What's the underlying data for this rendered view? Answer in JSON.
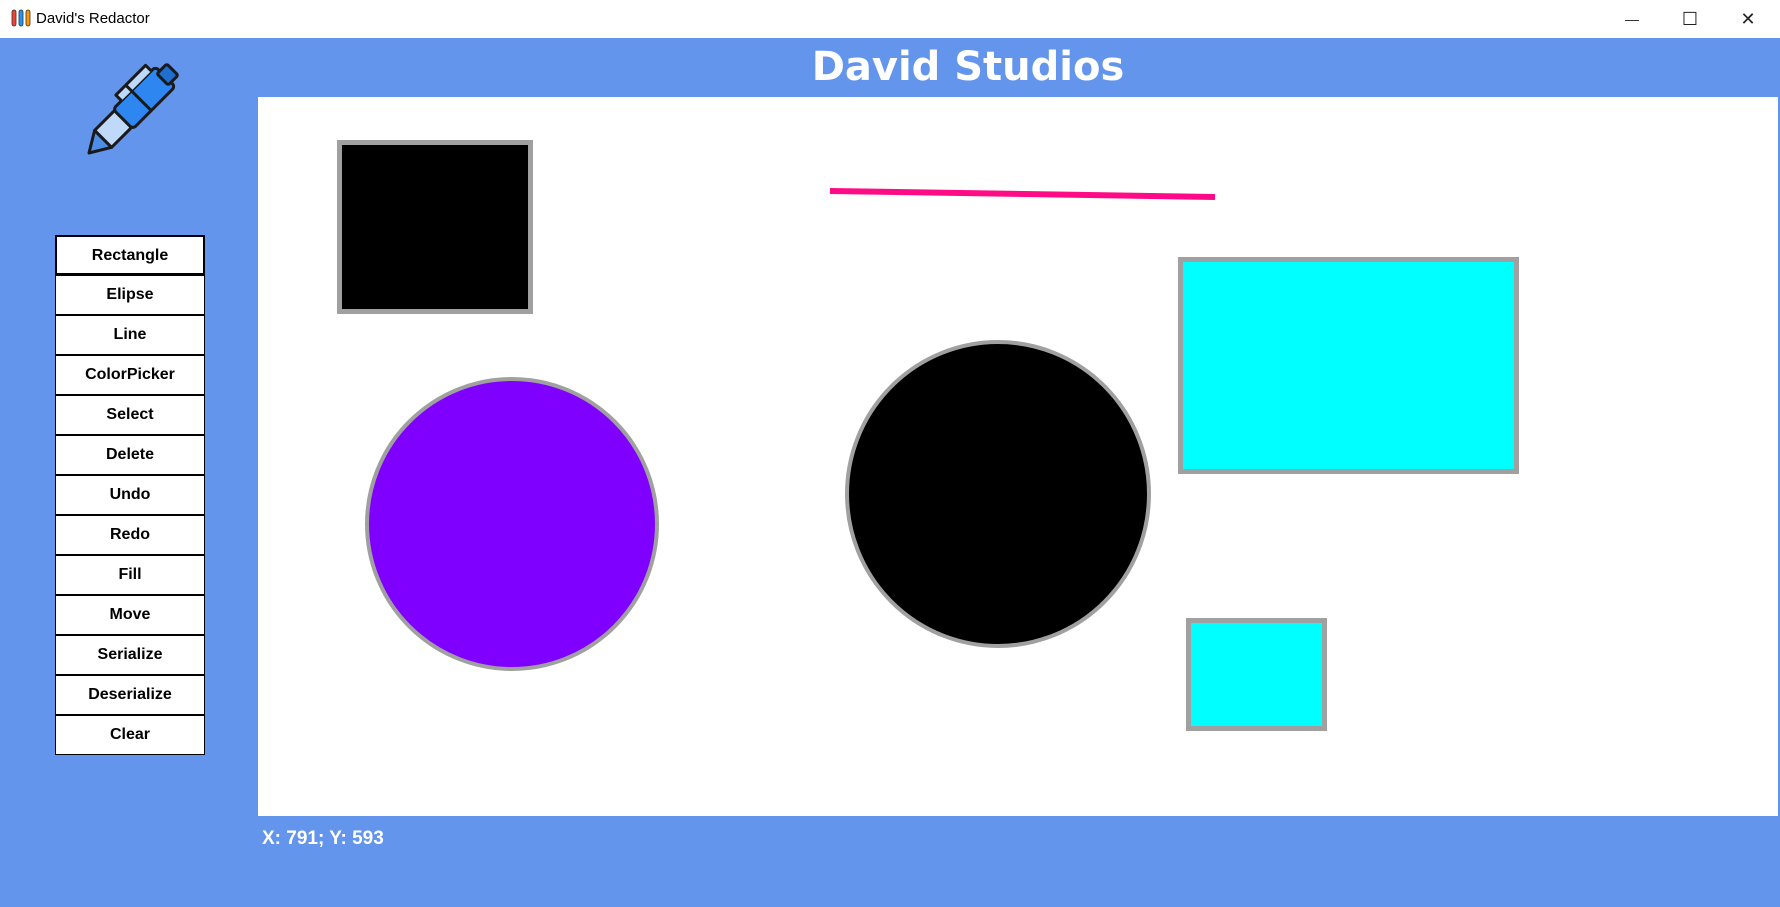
{
  "window": {
    "title": "David's Redactor",
    "controls": [
      "minimize",
      "maximize",
      "close"
    ],
    "minimize_glyph": "—",
    "maximize_glyph": "☐",
    "close_glyph": "✕"
  },
  "header": {
    "brand": "David Studios"
  },
  "logo": {
    "icon": "pen-icon"
  },
  "toolbar": {
    "buttons": [
      "Rectangle",
      "Elipse",
      "Line",
      "ColorPicker",
      "Select",
      "Delete",
      "Undo",
      "Redo",
      "Fill",
      "Move",
      "Serialize",
      "Deserialize",
      "Clear"
    ]
  },
  "canvas": {
    "shapes": [
      {
        "kind": "rectangle",
        "fill": "#000000",
        "stroke": "#A0A0A0"
      },
      {
        "kind": "line",
        "stroke": "#FF0B86"
      },
      {
        "kind": "ellipse",
        "fill": "#8000FF",
        "stroke": "#A0A0A0"
      },
      {
        "kind": "ellipse",
        "fill": "#000000",
        "stroke": "#A0A0A0"
      },
      {
        "kind": "rectangle",
        "fill": "#00FFFF",
        "stroke": "#A0A0A0"
      },
      {
        "kind": "rectangle",
        "fill": "#00FFFF",
        "stroke": "#A0A0A0"
      }
    ]
  },
  "status": {
    "cursor": "X: 791; Y: 593"
  },
  "colors": {
    "background": "#6495ED",
    "canvas": "#FFFFFF",
    "titlebar": "#FFFFFF"
  }
}
